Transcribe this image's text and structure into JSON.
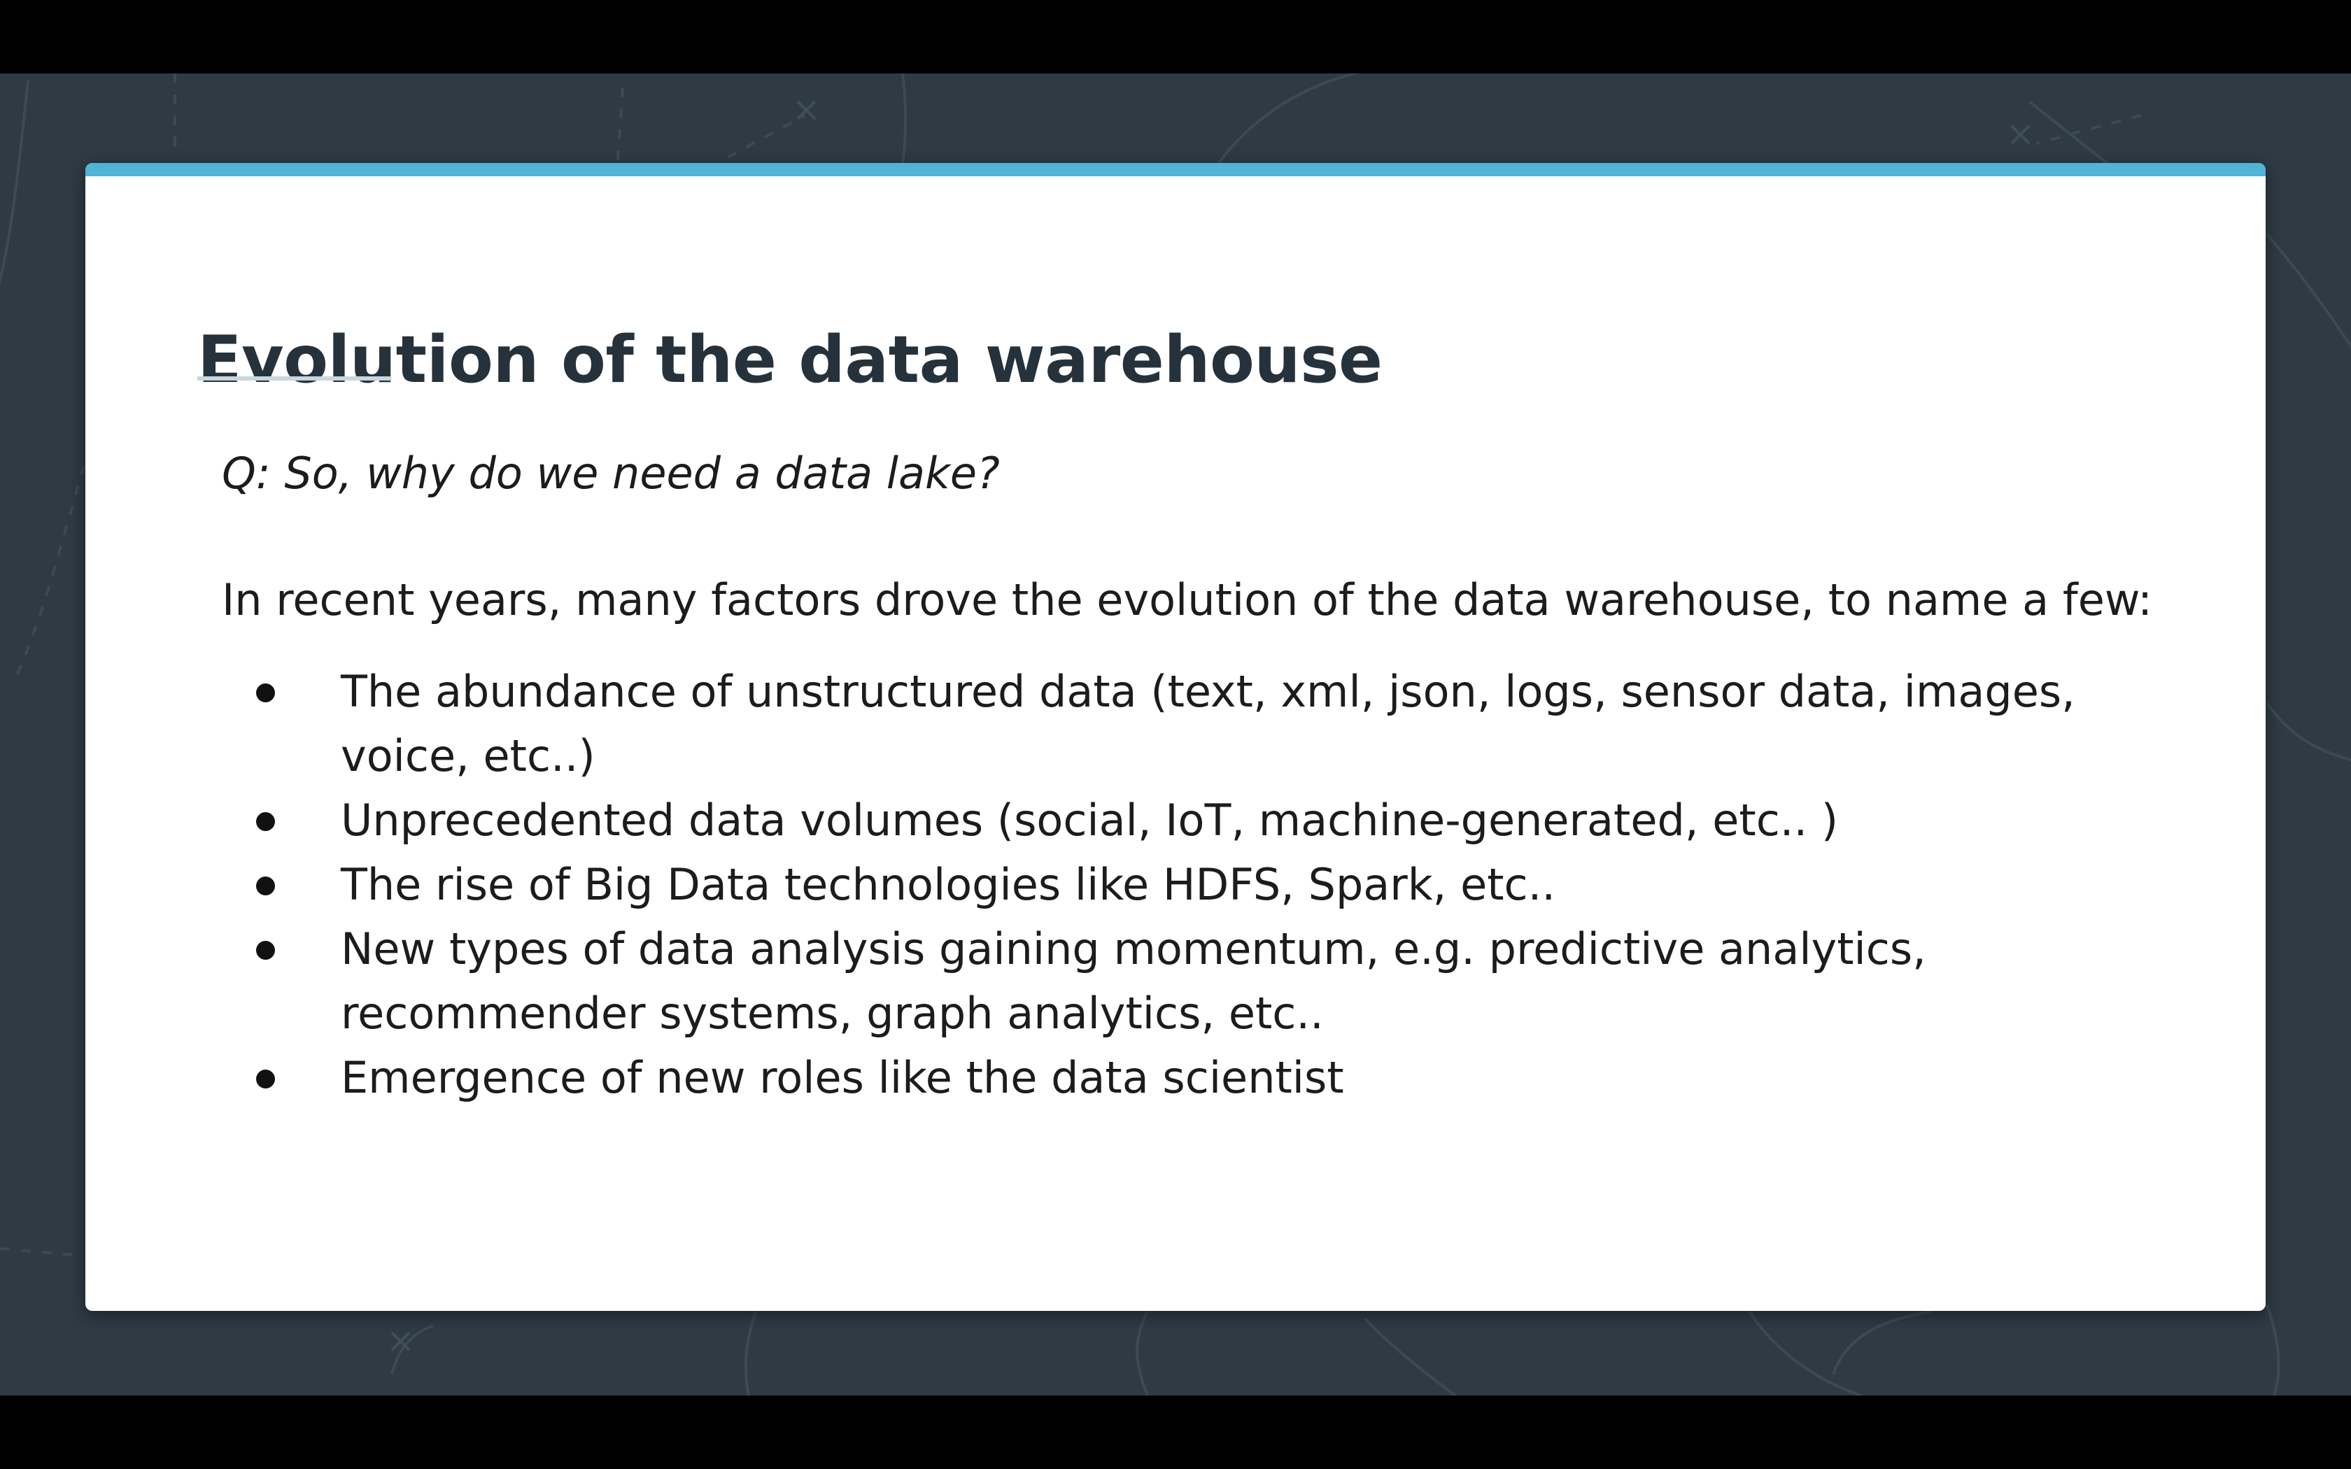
{
  "slide": {
    "title": "Evolution of the data warehouse",
    "question": "Q: So, why do we need a data lake?",
    "intro": "In recent years, many factors drove the evolution of the data warehouse, to name a few:",
    "bullets": [
      "The abundance of unstructured data (text, xml, json, logs, sensor data, images, voice, etc..)",
      "Unprecedented data volumes (social, IoT, machine-generated, etc.. )",
      "The rise of Big Data technologies like HDFS, Spark, etc..",
      "New types of data analysis gaining momentum, e.g. predictive analytics, recommender systems, graph analytics, etc..",
      "Emergence of new roles like the data scientist"
    ]
  },
  "colors": {
    "background": "#2e3b44",
    "card": "#ffffff",
    "accent_bar": "#4fb4d6",
    "title": "#26323b",
    "text": "#1c1c1c"
  }
}
